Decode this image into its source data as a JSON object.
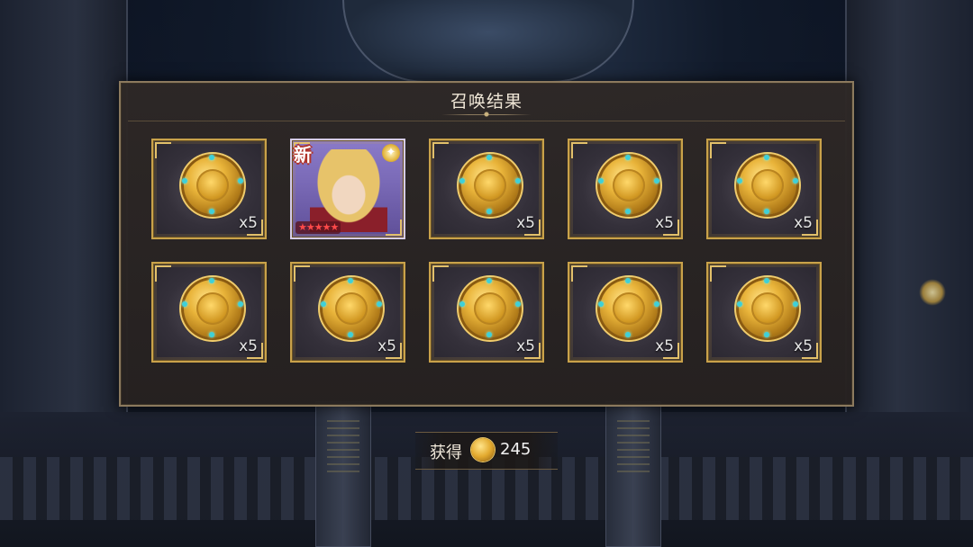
{
  "panel": {
    "title": "召唤结果"
  },
  "rewards": [
    {
      "type": "coin",
      "icon": "dragon-coin-icon",
      "qty": "x5"
    },
    {
      "type": "hero",
      "badge": "新",
      "rarity": "★★★★★"
    },
    {
      "type": "coin",
      "icon": "dragon-coin-icon",
      "qty": "x5"
    },
    {
      "type": "coin",
      "icon": "dragon-coin-icon",
      "qty": "x5"
    },
    {
      "type": "coin",
      "icon": "dragon-coin-icon",
      "qty": "x5"
    },
    {
      "type": "coin",
      "icon": "dragon-coin-icon",
      "qty": "x5"
    },
    {
      "type": "coin",
      "icon": "dragon-coin-icon",
      "qty": "x5"
    },
    {
      "type": "coin",
      "icon": "dragon-coin-icon",
      "qty": "x5"
    },
    {
      "type": "coin",
      "icon": "dragon-coin-icon",
      "qty": "x5"
    },
    {
      "type": "coin",
      "icon": "dragon-coin-icon",
      "qty": "x5"
    }
  ],
  "obtained": {
    "label": "获得",
    "icon": "dragon-coin-icon",
    "value": "245"
  },
  "colors": {
    "frame_gold": "#c9a24a",
    "panel_bg": "#2e2826",
    "hero_bg": "#7b6bb8",
    "rarity_star": "#ff4a4a"
  }
}
